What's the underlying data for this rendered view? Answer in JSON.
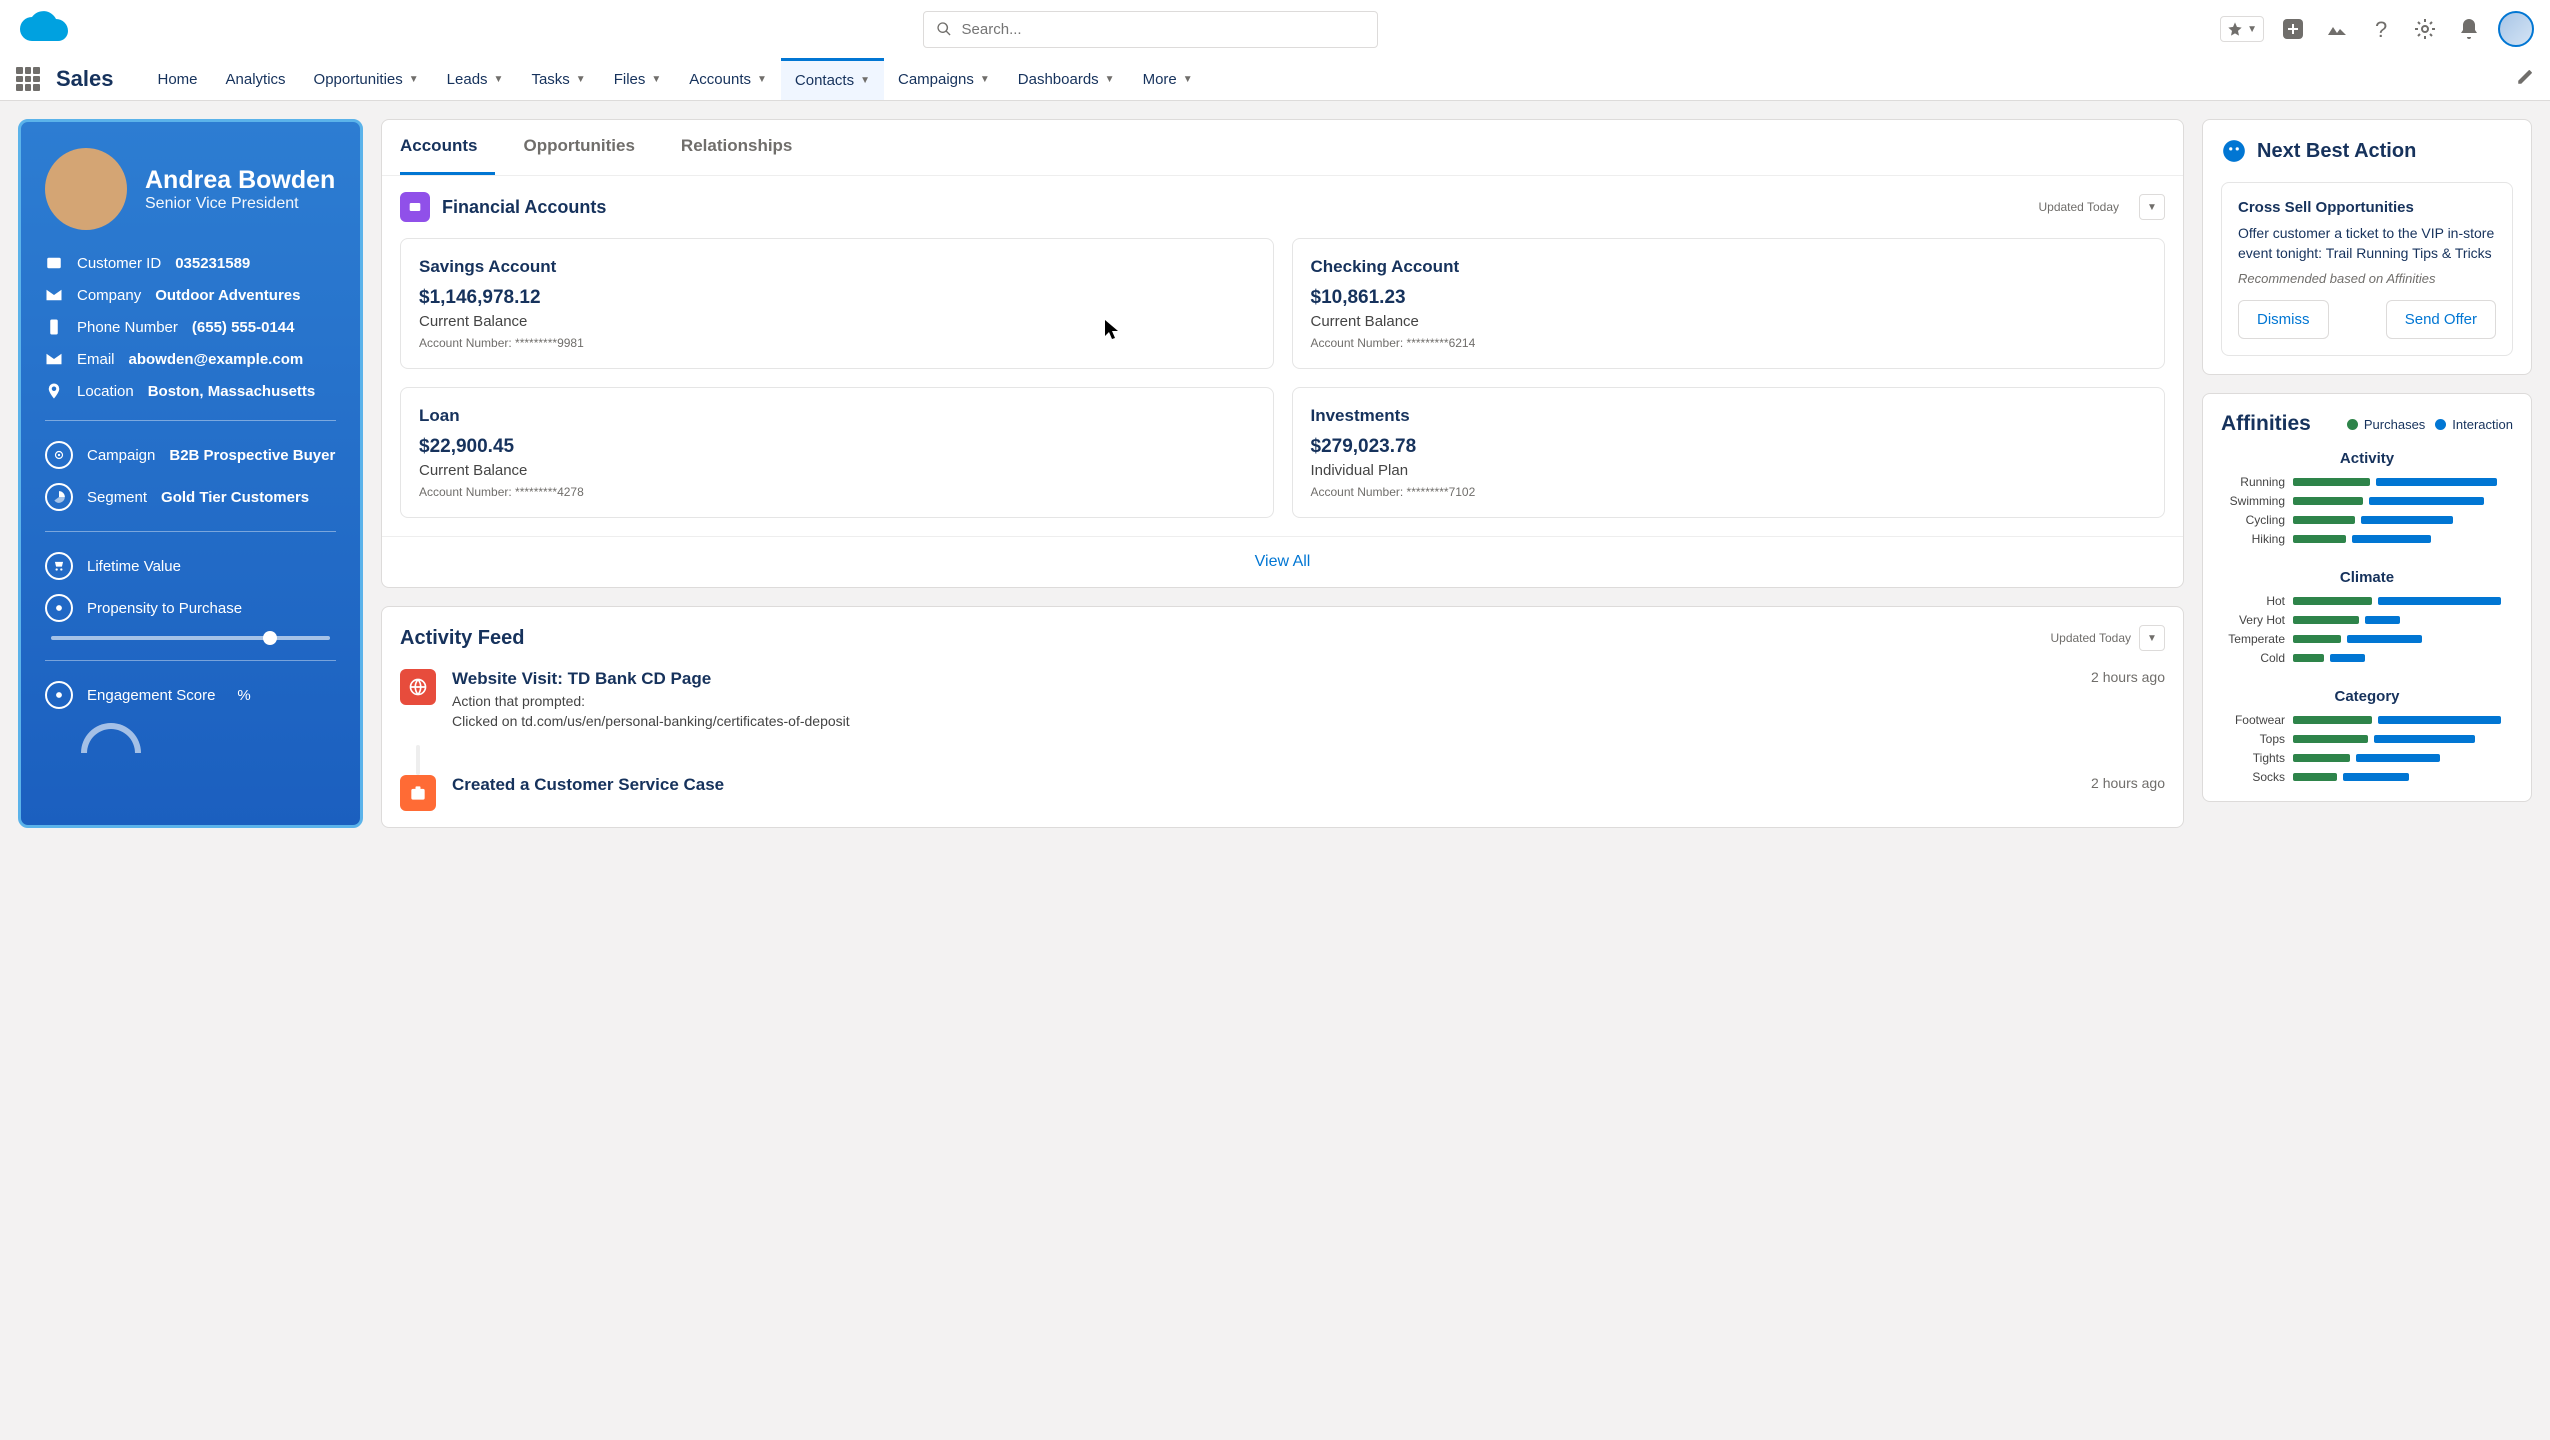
{
  "header": {
    "search_placeholder": "Search...",
    "app_name": "Sales",
    "nav": [
      "Home",
      "Analytics",
      "Opportunities",
      "Leads",
      "Tasks",
      "Files",
      "Accounts",
      "Contacts",
      "Campaigns",
      "Dashboards",
      "More"
    ],
    "active_nav": "Contacts"
  },
  "contact": {
    "name": "Andrea Bowden",
    "title": "Senior Vice President",
    "customer_id_label": "Customer ID",
    "customer_id": "035231589",
    "company_label": "Company",
    "company": "Outdoor Adventures",
    "phone_label": "Phone Number",
    "phone": "(655) 555-0144",
    "email_label": "Email",
    "email": "abowden@example.com",
    "location_label": "Location",
    "location": "Boston, Massachusetts",
    "campaign_label": "Campaign",
    "campaign": "B2B Prospective Buyer",
    "segment_label": "Segment",
    "segment": "Gold Tier Customers",
    "lifetime_value_label": "Lifetime Value",
    "propensity_label": "Propensity to Purchase",
    "engagement_label": "Engagement Score",
    "engagement_unit": "%"
  },
  "tabs": [
    "Accounts",
    "Opportunities",
    "Relationships"
  ],
  "active_tab": "Accounts",
  "financial": {
    "title": "Financial Accounts",
    "updated": "Updated Today",
    "accounts": [
      {
        "name": "Savings Account",
        "balance": "$1,146,978.12",
        "sub": "Current Balance",
        "num": "Account Number: *********9981"
      },
      {
        "name": "Checking Account",
        "balance": "$10,861.23",
        "sub": "Current Balance",
        "num": "Account Number: *********6214"
      },
      {
        "name": "Loan",
        "balance": "$22,900.45",
        "sub": "Current Balance",
        "num": "Account Number: *********4278"
      },
      {
        "name": "Investments",
        "balance": "$279,023.78",
        "sub": "Individual Plan",
        "num": "Account Number: *********7102"
      }
    ],
    "view_all": "View All"
  },
  "activity": {
    "title": "Activity Feed",
    "updated": "Updated Today",
    "items": [
      {
        "title": "Website Visit: TD Bank CD Page",
        "sub1": "Action that prompted:",
        "sub2": "Clicked on td.com/us/en/personal-banking/certificates-of-deposit",
        "time": "2 hours ago"
      },
      {
        "title": "Created a Customer Service Case",
        "sub1": "",
        "sub2": "",
        "time": "2 hours ago"
      }
    ]
  },
  "nba": {
    "heading": "Next Best Action",
    "title": "Cross Sell Opportunities",
    "text": "Offer customer a ticket to the VIP in-store event tonight: Trail Running Tips & Tricks",
    "rec": "Recommended based on Affinities",
    "dismiss": "Dismiss",
    "send": "Send Offer"
  },
  "affinities": {
    "title": "Affinities",
    "legend_purchases": "Purchases",
    "legend_interaction": "Interaction",
    "sections": [
      {
        "name": "Activity",
        "rows": [
          {
            "label": "Running",
            "p": 35,
            "i": 55
          },
          {
            "label": "Swimming",
            "p": 32,
            "i": 52
          },
          {
            "label": "Cycling",
            "p": 28,
            "i": 42
          },
          {
            "label": "Hiking",
            "p": 24,
            "i": 36
          }
        ]
      },
      {
        "name": "Climate",
        "rows": [
          {
            "label": "Hot",
            "p": 36,
            "i": 56
          },
          {
            "label": "Very Hot",
            "p": 30,
            "i": 16
          },
          {
            "label": "Temperate",
            "p": 22,
            "i": 34
          },
          {
            "label": "Cold",
            "p": 14,
            "i": 16
          }
        ]
      },
      {
        "name": "Category",
        "rows": [
          {
            "label": "Footwear",
            "p": 36,
            "i": 56
          },
          {
            "label": "Tops",
            "p": 34,
            "i": 46
          },
          {
            "label": "Tights",
            "p": 26,
            "i": 38
          },
          {
            "label": "Socks",
            "p": 20,
            "i": 30
          }
        ]
      }
    ]
  }
}
